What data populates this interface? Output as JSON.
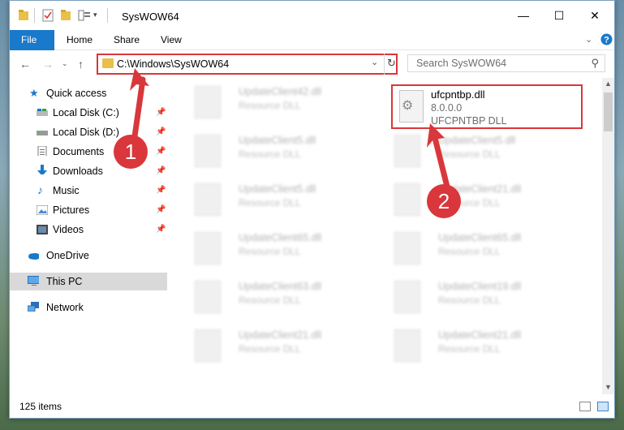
{
  "window": {
    "title": "SysWOW64"
  },
  "window_controls": {
    "minimize": "—",
    "maximize": "☐",
    "close": "✕"
  },
  "ribbon": {
    "tabs": [
      "File",
      "Home",
      "Share",
      "View"
    ]
  },
  "address": {
    "path": "C:\\Windows\\SysWOW64"
  },
  "search": {
    "placeholder": "Search SysWOW64"
  },
  "nav": {
    "quick_access": "Quick access",
    "items": [
      {
        "label": "Local Disk (C:)",
        "pinned": true
      },
      {
        "label": "Local Disk (D:)",
        "pinned": true
      },
      {
        "label": "Documents",
        "pinned": true
      },
      {
        "label": "Downloads",
        "pinned": true
      },
      {
        "label": "Music",
        "pinned": true
      },
      {
        "label": "Pictures",
        "pinned": true
      },
      {
        "label": "Videos",
        "pinned": true
      }
    ],
    "onedrive": "OneDrive",
    "this_pc": "This PC",
    "network": "Network"
  },
  "files": {
    "left_column": [
      {
        "name": "UpdateClient42.dll",
        "desc": "Resource DLL"
      },
      {
        "name": "UpdateClient5.dll",
        "desc": "Resource DLL"
      },
      {
        "name": "UpdateClient5.dll",
        "desc": "Resource DLL"
      },
      {
        "name": "UpdateClient65.dll",
        "desc": "Resource DLL"
      },
      {
        "name": "UpdateClient63.dll",
        "desc": "Resource DLL"
      },
      {
        "name": "UpdateClient21.dll",
        "desc": "Resource DLL"
      }
    ],
    "right_column": [
      {
        "name": "UpdateClient5.dll",
        "desc": "Resource DLL"
      },
      {
        "name": "UpdateClient21.dll",
        "desc": "Resource DLL"
      },
      {
        "name": "UpdateClient65.dll",
        "desc": "Resource DLL"
      },
      {
        "name": "UpdateClient19.dll",
        "desc": "Resource DLL"
      },
      {
        "name": "UpdateClient21.dll",
        "desc": "Resource DLL"
      }
    ],
    "highlighted": {
      "name": "ufcpntbp.dll",
      "version": "8.0.0.0",
      "description": "UFCPNTBP DLL"
    }
  },
  "status": {
    "item_count": "125 items"
  },
  "annotations": {
    "marker1": "1",
    "marker2": "2"
  },
  "colors": {
    "accent": "#1979ca",
    "annotation_red": "#d9373b",
    "selected_bg": "#d9d9d9"
  }
}
